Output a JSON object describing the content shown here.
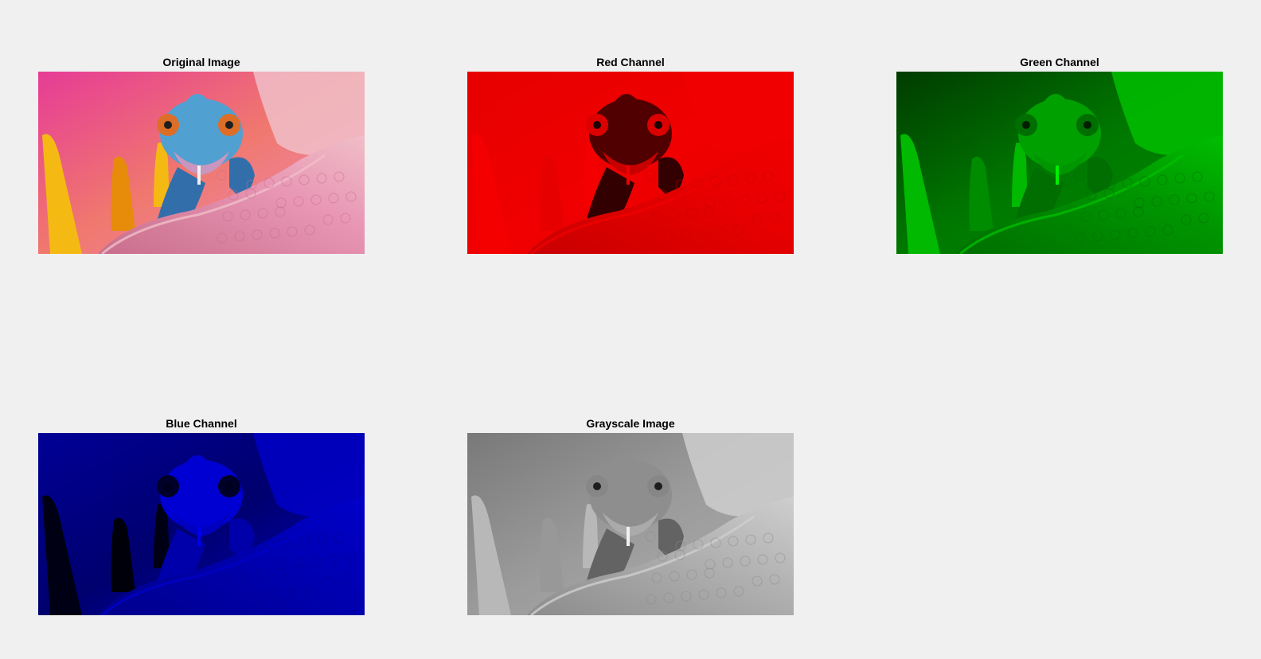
{
  "figure": {
    "subplots": [
      {
        "title": "Original Image",
        "mode": "original"
      },
      {
        "title": "Red Channel",
        "mode": "red"
      },
      {
        "title": "Green Channel",
        "mode": "green"
      },
      {
        "title": "Blue Channel",
        "mode": "blue"
      },
      {
        "title": "Grayscale Image",
        "mode": "gray"
      }
    ]
  },
  "colors": {
    "background": "#f0f0f0",
    "title_text": "#000000"
  },
  "icons": {
    "image_content": "chameleon-on-flower-petal-photo"
  }
}
